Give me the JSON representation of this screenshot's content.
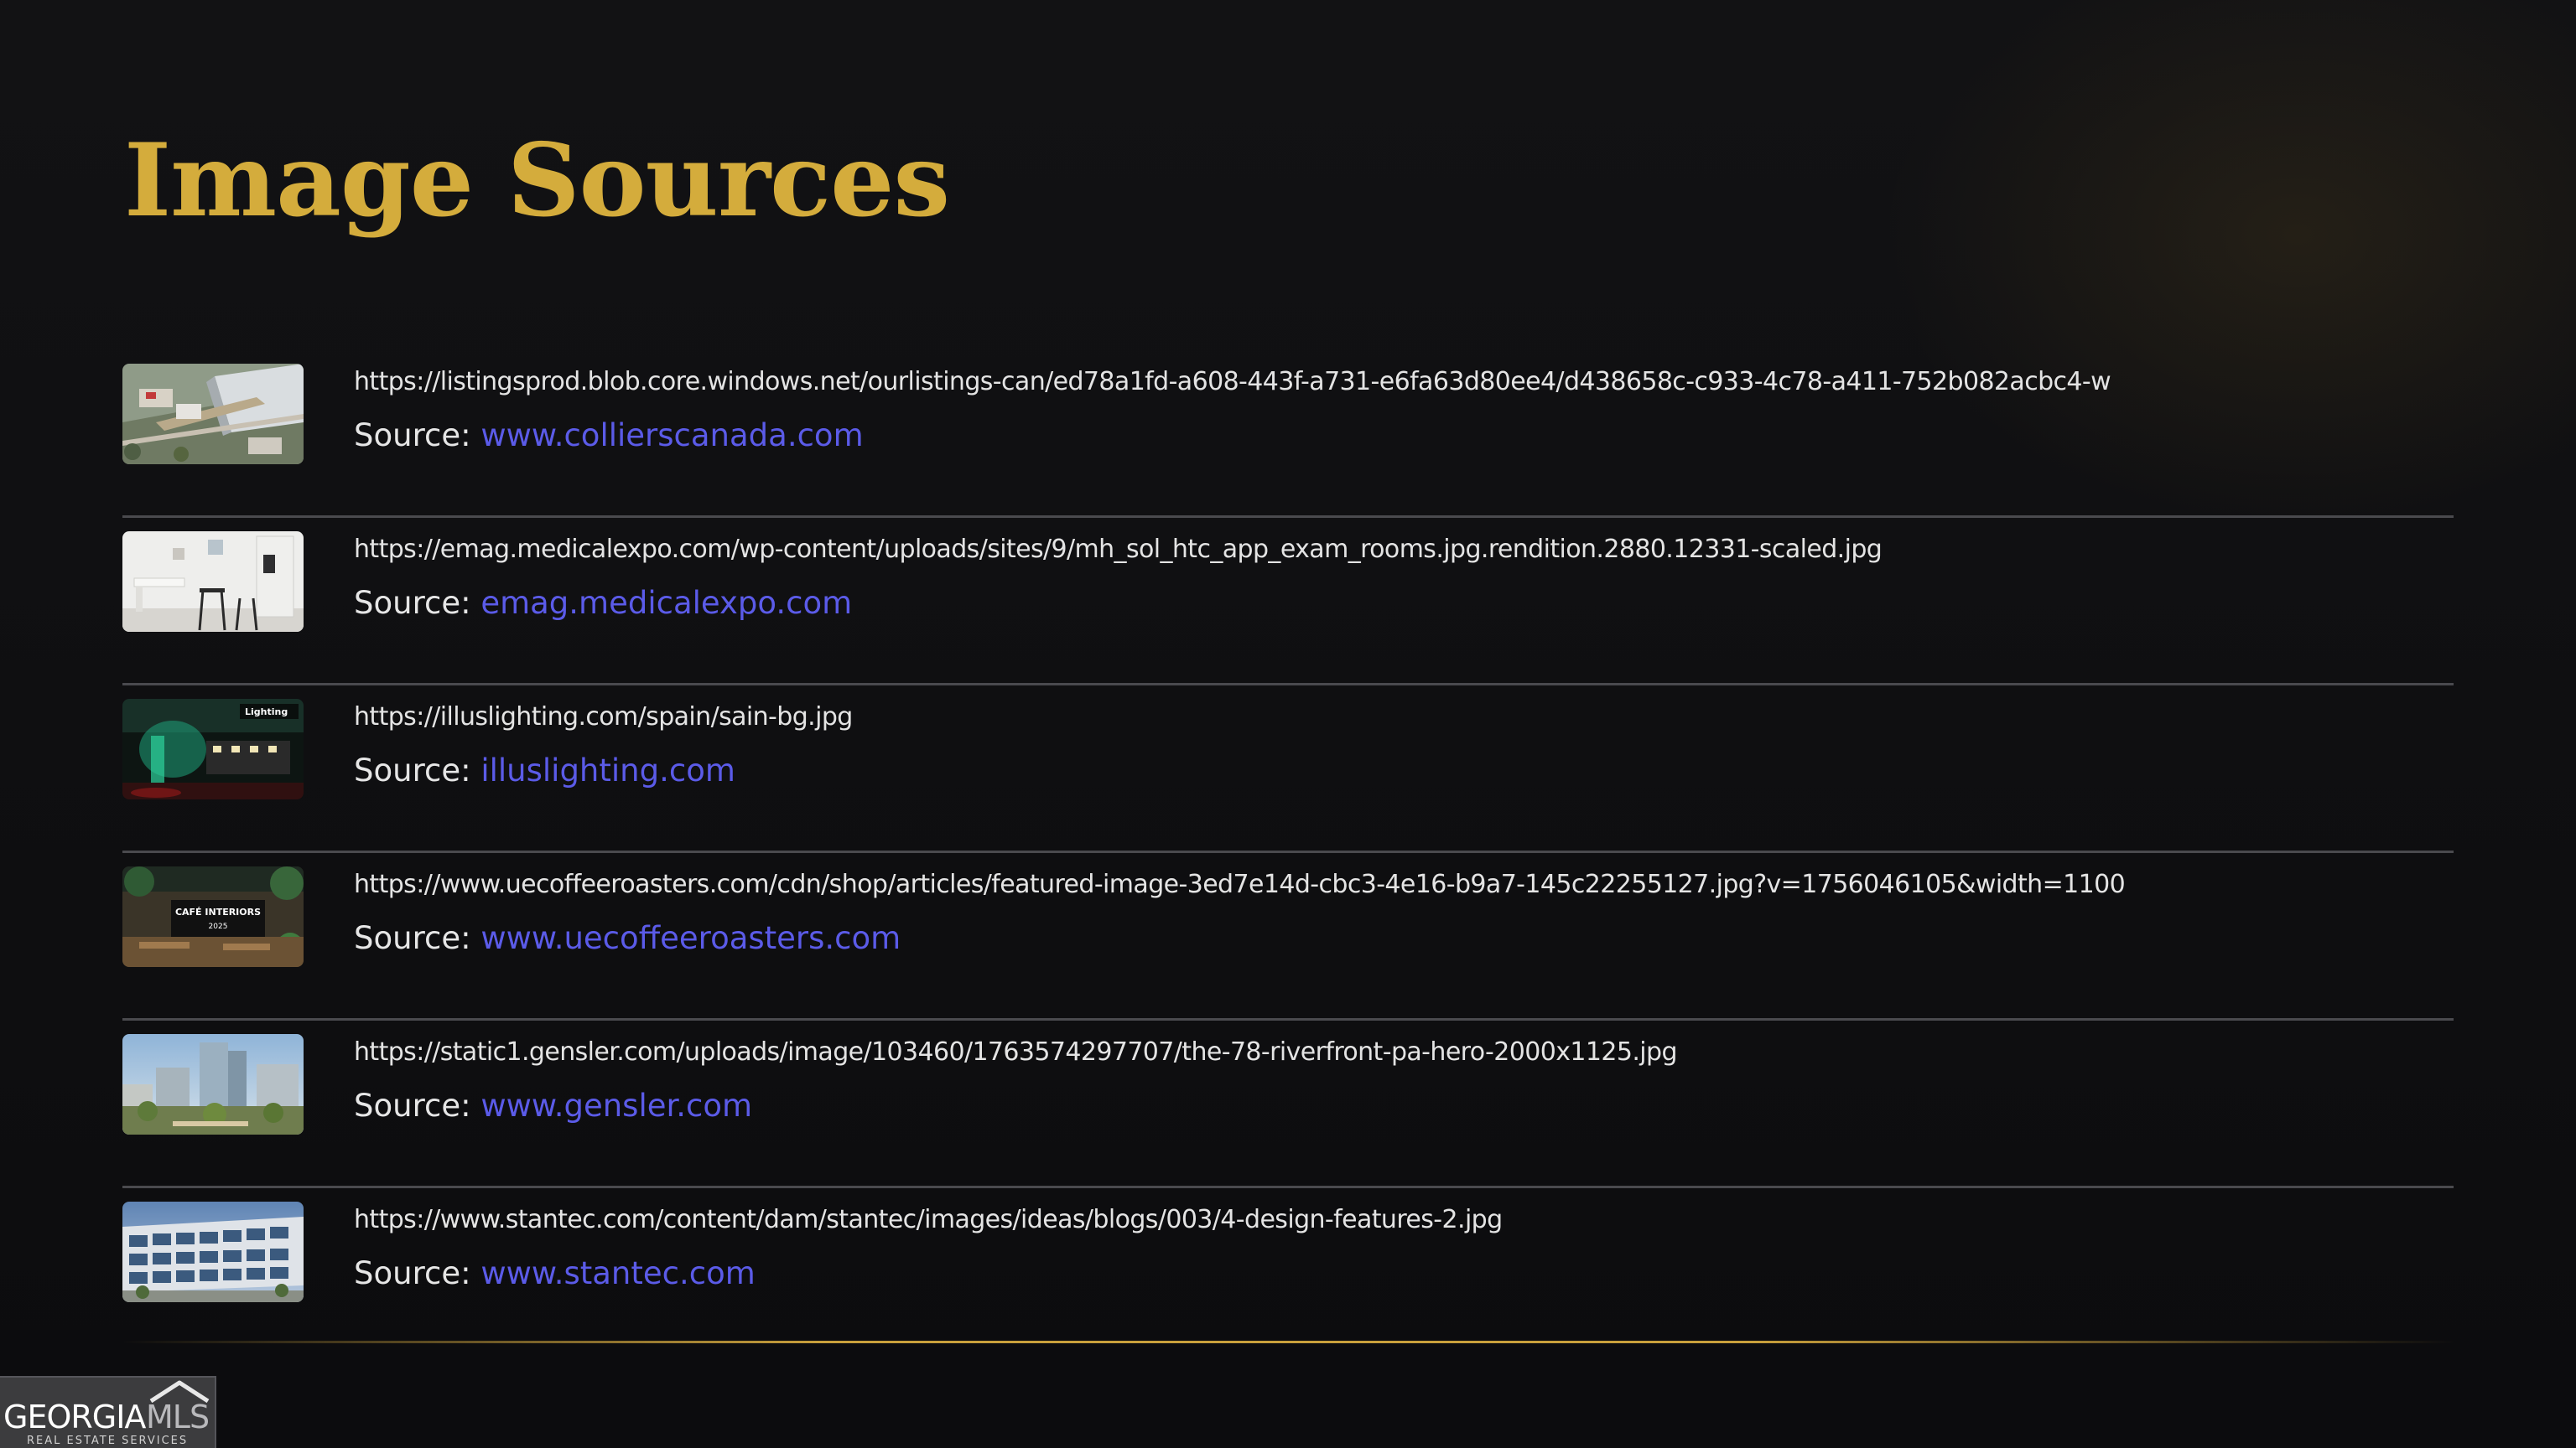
{
  "slide": {
    "title": "Image Sources",
    "source_label": "Source: ",
    "sources": [
      {
        "thumbnail": "aerial-industrial-photo",
        "url": "https://listingsprod.blob.core.windows.net/ourlistings-can/ed78a1fd-a608-443f-a731-e6fa63d80ee4/d438658c-c933-4c78-a411-752b082acbc4-w",
        "domain": "www.collierscanada.com"
      },
      {
        "thumbnail": "exam-room-photo",
        "url": "https://emag.medicalexpo.com/wp-content/uploads/sites/9/mh_sol_htc_app_exam_rooms.jpg.rendition.2880.12331-scaled.jpg",
        "domain": "emag.medicalexpo.com"
      },
      {
        "thumbnail": "lighting-showroom-photo",
        "url": "https://illuslighting.com/spain/sain-bg.jpg",
        "domain": "illuslighting.com"
      },
      {
        "thumbnail": "cafe-interior-photo",
        "url": "https://www.uecoffeeroasters.com/cdn/shop/articles/featured-image-3ed7e14d-cbc3-4e16-b9a7-145c22255127.jpg?v=1756046105&width=1100",
        "domain": "www.uecoffeeroasters.com"
      },
      {
        "thumbnail": "riverfront-building-photo",
        "url": "https://static1.gensler.com/uploads/image/103460/1763574297707/the-78-riverfront-pa-hero-2000x1125.jpg",
        "domain": "www.gensler.com"
      },
      {
        "thumbnail": "office-building-photo",
        "url": "https://www.stantec.com/content/dam/stantec/images/ideas/blogs/003/4-design-features-2.jpg",
        "domain": "www.stantec.com"
      }
    ],
    "thumbnail_text": {
      "lighting_sign": "Lighting",
      "cafe_sign_line1": "CAFÉ INTERIORS",
      "cafe_sign_line2": "2025"
    }
  },
  "logo": {
    "word_georgia": "GEORGIA",
    "word_mls": "MLS",
    "tagline": "REAL ESTATE SERVICES"
  },
  "colors": {
    "background": "#0d0d0f",
    "title_gold": "#d4ac3c",
    "link_blue": "#5b5be8",
    "body_text": "#e4e4e4",
    "divider": "#4a4a4e"
  }
}
